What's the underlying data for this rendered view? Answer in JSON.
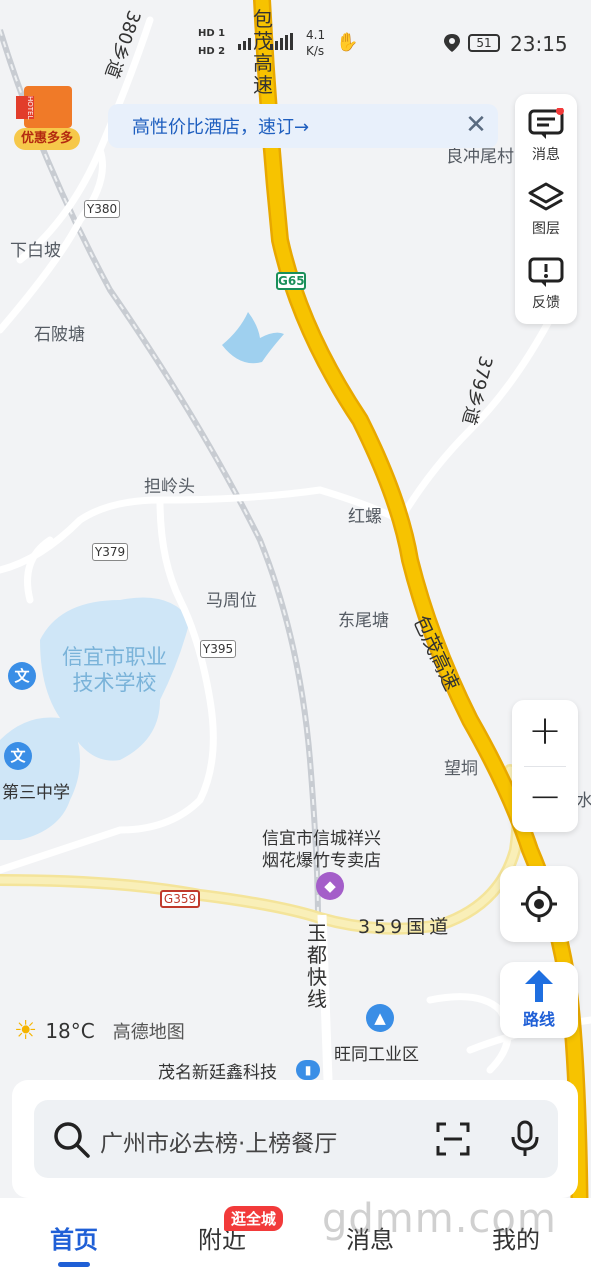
{
  "status_bar": {
    "time": "23:15",
    "battery": "51",
    "speed_value": "4.1",
    "speed_unit": "K/s",
    "sim1": "HD 1",
    "sim2": "HD 2"
  },
  "hotel_badge": {
    "label": "优惠多多",
    "sign": "HOTEL"
  },
  "banner": {
    "text": "高性价比酒店，速订→",
    "close": "✕"
  },
  "side_panel": {
    "messages_label": "消息",
    "layers_label": "图层",
    "feedback_label": "反馈"
  },
  "map": {
    "labels": {
      "xiabaipo": "下白坡",
      "shibeitang": "石陂塘",
      "danlingtou": "担岭头",
      "hongluo": "红螺",
      "mazhouwei": "马周位",
      "dongweitang": "东尾塘",
      "wangdong": "望垌",
      "liangchongwei": "良冲尾村",
      "vocational_school": "信宜市职业\n技术学校",
      "third_school": "第三中学",
      "firework_shop": "信宜市信城祥兴\n烟花爆竹专卖店",
      "wangtong_park": "旺同工业区",
      "maoming_tech": "茂名新廷鑫科技",
      "shui": "水"
    },
    "road_codes": {
      "g65": "G65",
      "y380": "Y380",
      "y379": "Y379",
      "y395": "Y395",
      "g359": "G359"
    },
    "road_names": {
      "baomao_top": "包茂高速",
      "baomao_mid": "包茂高速",
      "xiangdao_380": "380乡道",
      "xiangdao_379": "379乡道",
      "guodao_359": "359国道",
      "yudu": "玉都快线"
    }
  },
  "zoom": {
    "plus": "+",
    "minus": "−"
  },
  "route_button": {
    "label": "路线"
  },
  "weather": {
    "temp": "18°C",
    "provider": "高德地图"
  },
  "search": {
    "placeholder": "广州市必去榜·上榜餐厅"
  },
  "tabs": {
    "home": "首页",
    "nearby": "附近",
    "nearby_badge": "逛全城",
    "messages": "消息",
    "mine": "我的"
  },
  "watermark": "gdmm.com",
  "colors": {
    "highway": "#f7b900",
    "national_road": "#f4e49a",
    "water": "#bfe0f5",
    "accent": "#1f5fd6"
  }
}
